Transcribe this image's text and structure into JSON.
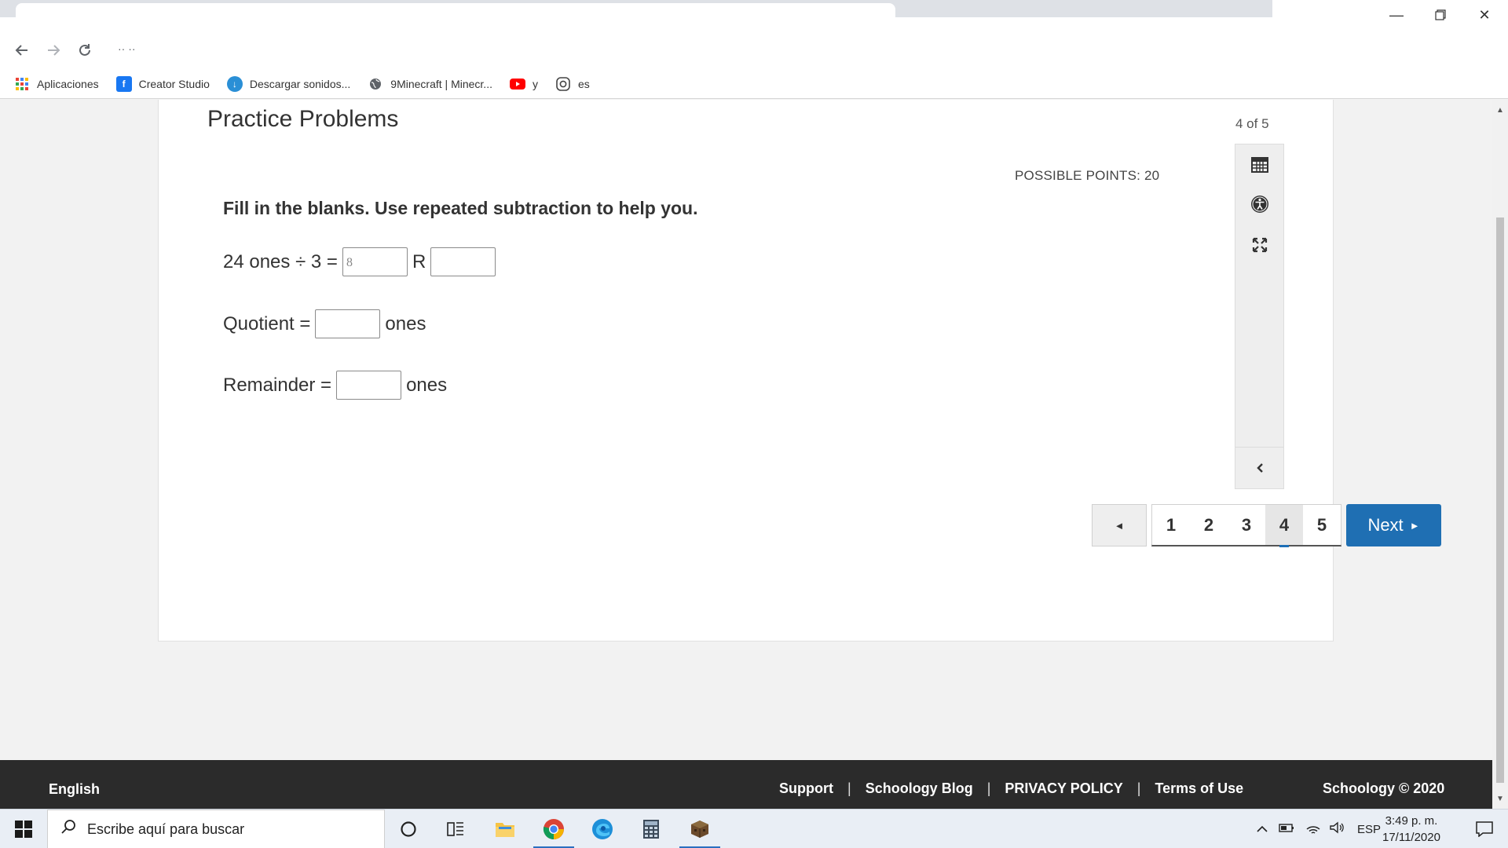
{
  "browser": {
    "address_text": "··         ··",
    "bookmarks": [
      {
        "label": "Aplicaciones",
        "icon": "apps-grid-icon"
      },
      {
        "label": "Creator Studio",
        "icon": "facebook-icon"
      },
      {
        "label": "Descargar sonidos...",
        "icon": "download-icon"
      },
      {
        "label": "9Minecraft | Minecr...",
        "icon": "globe-icon"
      },
      {
        "label": "y",
        "icon": "youtube-icon"
      },
      {
        "label": "es",
        "icon": "instagram-icon"
      }
    ]
  },
  "quiz": {
    "title": "Practice Problems",
    "counter": "4 of 5",
    "possible_points": "POSSIBLE POINTS: 20",
    "instruction": "Fill in the blanks.  Use repeated subtraction to help you.",
    "line1": {
      "prefix": "24 ones ÷ 3 =",
      "blank1_value": "8",
      "mid": "R",
      "blank2_value": ""
    },
    "line2": {
      "prefix": "Quotient =",
      "value": "",
      "suffix": "ones"
    },
    "line3": {
      "prefix": "Remainder =",
      "value": "",
      "suffix": "ones"
    }
  },
  "pager": {
    "prev": "◄",
    "pages": [
      "1",
      "2",
      "3",
      "4",
      "5"
    ],
    "current_page": "4",
    "next_label": "Next",
    "next_arrow": "►"
  },
  "footer": {
    "language": "English",
    "links": [
      "Support",
      "Schoology Blog",
      "PRIVACY POLICY",
      "Terms of Use"
    ],
    "separator": "|",
    "copyright": "Schoology © 2020"
  },
  "taskbar": {
    "search_placeholder": "Escribe aquí para buscar",
    "language": "ESP",
    "time": "3:49 p. m.",
    "date": "17/11/2020"
  },
  "colors": {
    "accent": "#1f6fb3",
    "footer_bg": "#2b2b2b",
    "page_bg": "#f2f2f2"
  }
}
